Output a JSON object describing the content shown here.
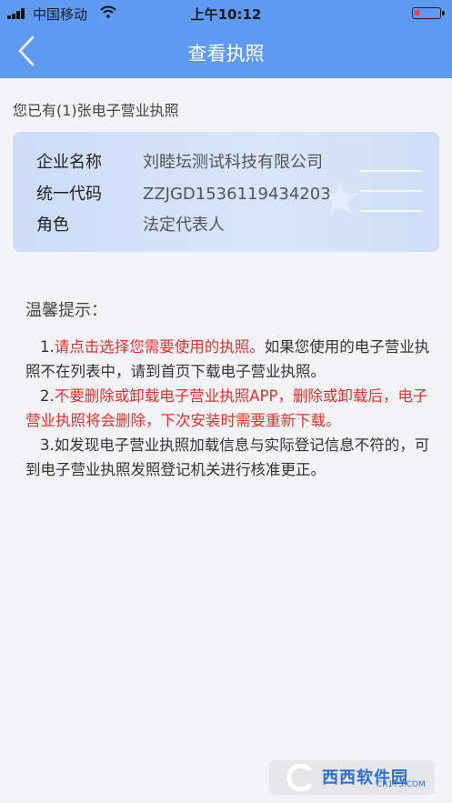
{
  "status": {
    "carrier": "中国移动",
    "time": "上午10:12"
  },
  "nav": {
    "title": "查看执照"
  },
  "owned_text": "您已有(1)张电子营业执照",
  "license": {
    "rows": [
      {
        "label": "企业名称",
        "value": "刘睦坛测试科技有限公司"
      },
      {
        "label": "统一代码",
        "value": "ZZJGD1536119434203"
      },
      {
        "label": "角色",
        "value": "法定代表人"
      }
    ]
  },
  "tips": {
    "title": "温馨提示：",
    "p1_num": "1.",
    "p1_red": "请点击选择您需要使用的执照。",
    "p1_rest": "如果您使用的电子营业执照不在列表中，请到首页下载电子营业执照。",
    "p2_num": "2.",
    "p2_red": "不要删除或卸载电子营业执照APP，删除或卸载后，电子营业执照将会删除，下次安装时需要重新下载。",
    "p3": "3.如发现电子营业执照加载信息与实际登记信息不符的，可到电子营业执照发照登记机关进行核准更正。"
  },
  "watermark": {
    "name": "西西软件园",
    "domain": "CR173.COM"
  },
  "colors": {
    "header": "#5e9af2",
    "warning": "#e6302c",
    "card": "#d3e1f9"
  }
}
